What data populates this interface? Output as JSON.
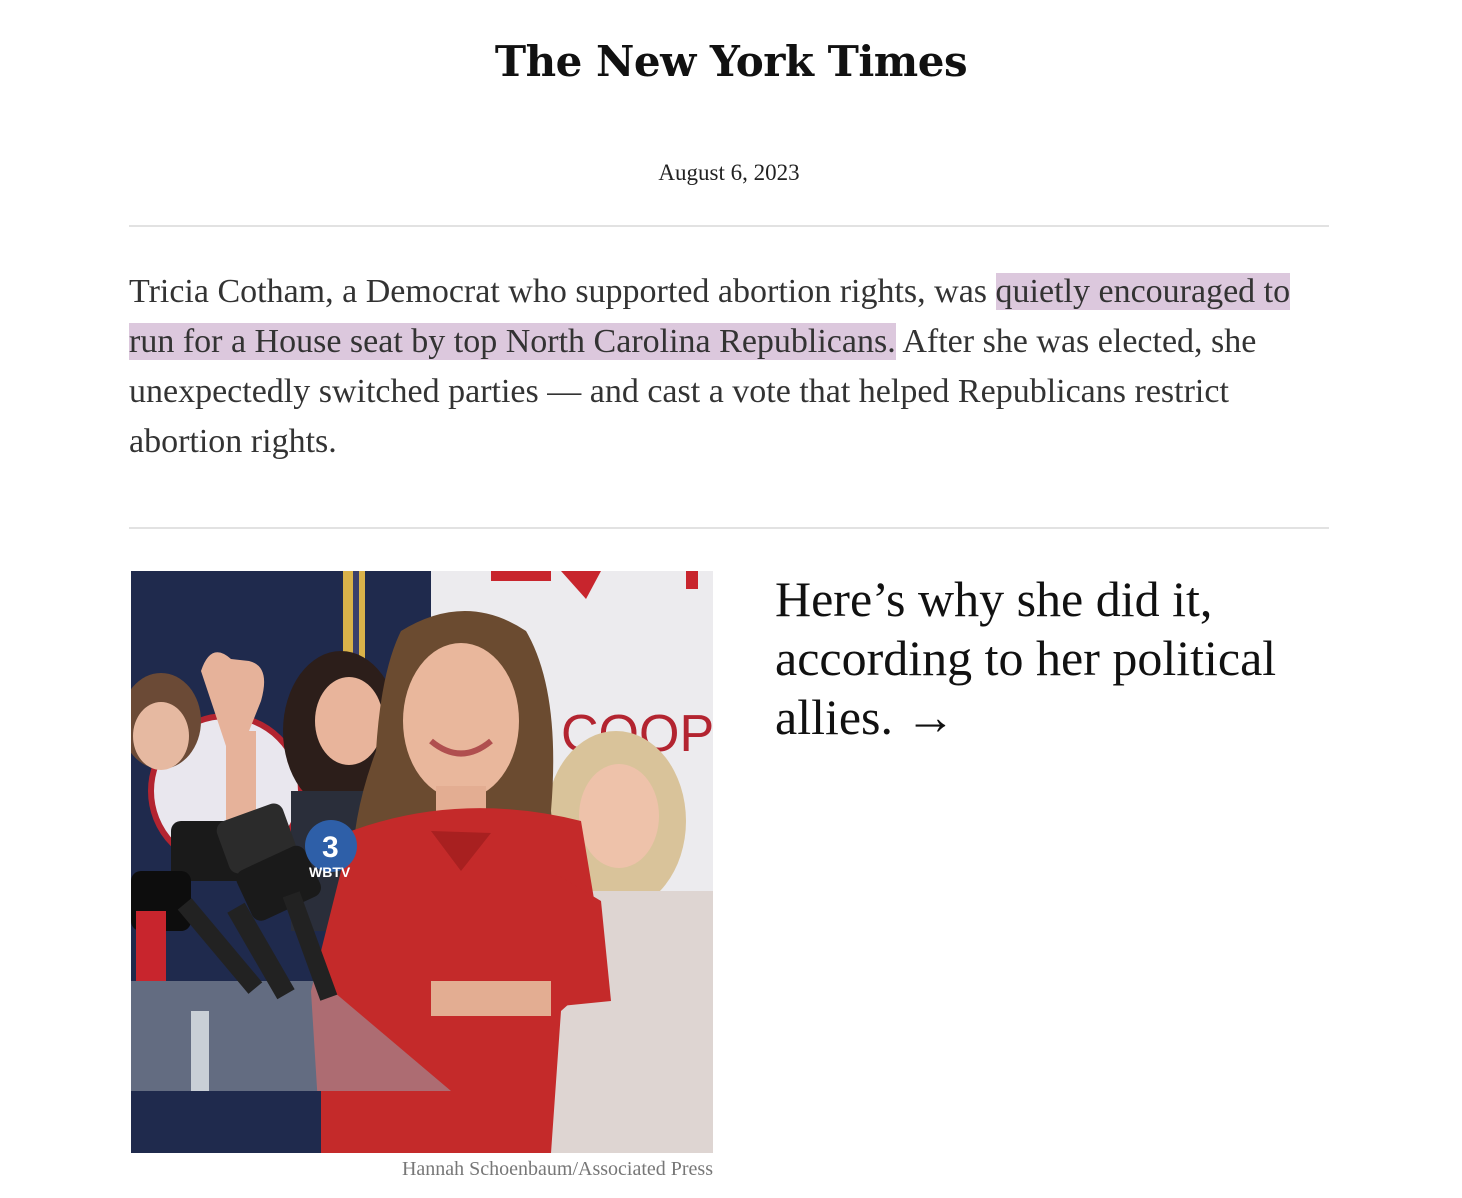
{
  "masthead": {
    "logo_text": "The New York Times"
  },
  "dateline": "August 6, 2023",
  "summary": {
    "text_before": "Tricia Cotham, a Democrat who supported abortion rights, was ",
    "highlighted": "quietly encouraged to run for a House seat by top North Carolina Republicans.",
    "text_after": " After she was elected, she unexpectedly switched parties — and cast a vote that helped Republicans restrict abortion rights.",
    "highlight_color": "#dcc8dd"
  },
  "photo": {
    "credit": "Hannah Schoenbaum/Associated Press",
    "sign_text": "COOP",
    "mic_label": "WBTV",
    "mic_number": "3"
  },
  "cta": {
    "text": "Here’s why she did it, according to her political allies. →"
  },
  "colors": {
    "rule": "#e2e2e2",
    "body_text": "#333333",
    "credit_text": "#777777"
  }
}
